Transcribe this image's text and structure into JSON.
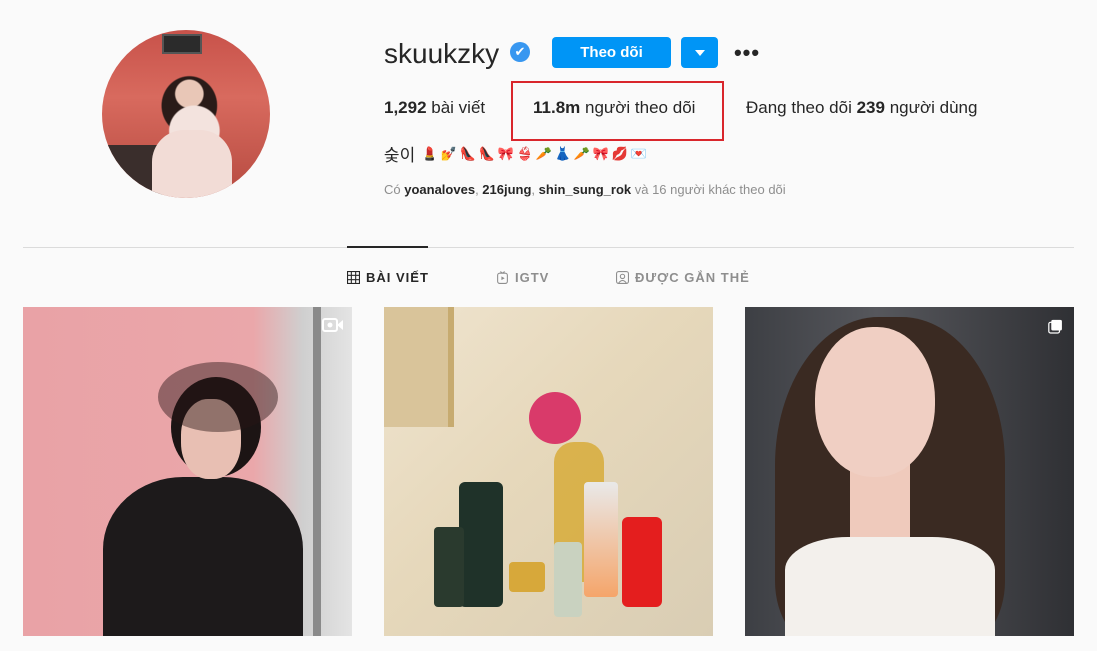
{
  "profile": {
    "username": "skuukzky",
    "verified_icon": "✔",
    "follow_label": "Theo dõi",
    "more_label": "•••",
    "stats": {
      "posts_count": "1,292",
      "posts_label": " bài viết",
      "followers_count": "11.8m",
      "followers_label": " người theo dõi",
      "following_prefix": "Đang theo dõi ",
      "following_count": "239",
      "following_label": " người dùng"
    },
    "bio_name": "숮이",
    "bio_emojis": [
      "💄",
      "💅",
      "👠",
      "👠",
      "🎀",
      "👙",
      "🥕",
      "👗",
      "🥕",
      "🎀",
      "💋",
      "💌"
    ],
    "followed_by": {
      "prefix": "Có ",
      "user1": "yoanaloves",
      "sep1": ", ",
      "user2": "216jung",
      "sep2": ", ",
      "user3": "shin_sung_rok",
      "suffix": " và 16 người khác theo dõi"
    }
  },
  "tabs": {
    "posts": "BÀI VIẾT",
    "igtv": "IGTV",
    "tagged": "ĐƯỢC GẮN THẺ"
  },
  "colors": {
    "accent": "#0095f6",
    "highlight": "#d9262c",
    "text": "#262626",
    "muted": "#8e8e8e"
  },
  "posts": [
    {
      "badge": "video-icon"
    },
    {
      "badge": ""
    },
    {
      "badge": "multiple-icon"
    }
  ]
}
